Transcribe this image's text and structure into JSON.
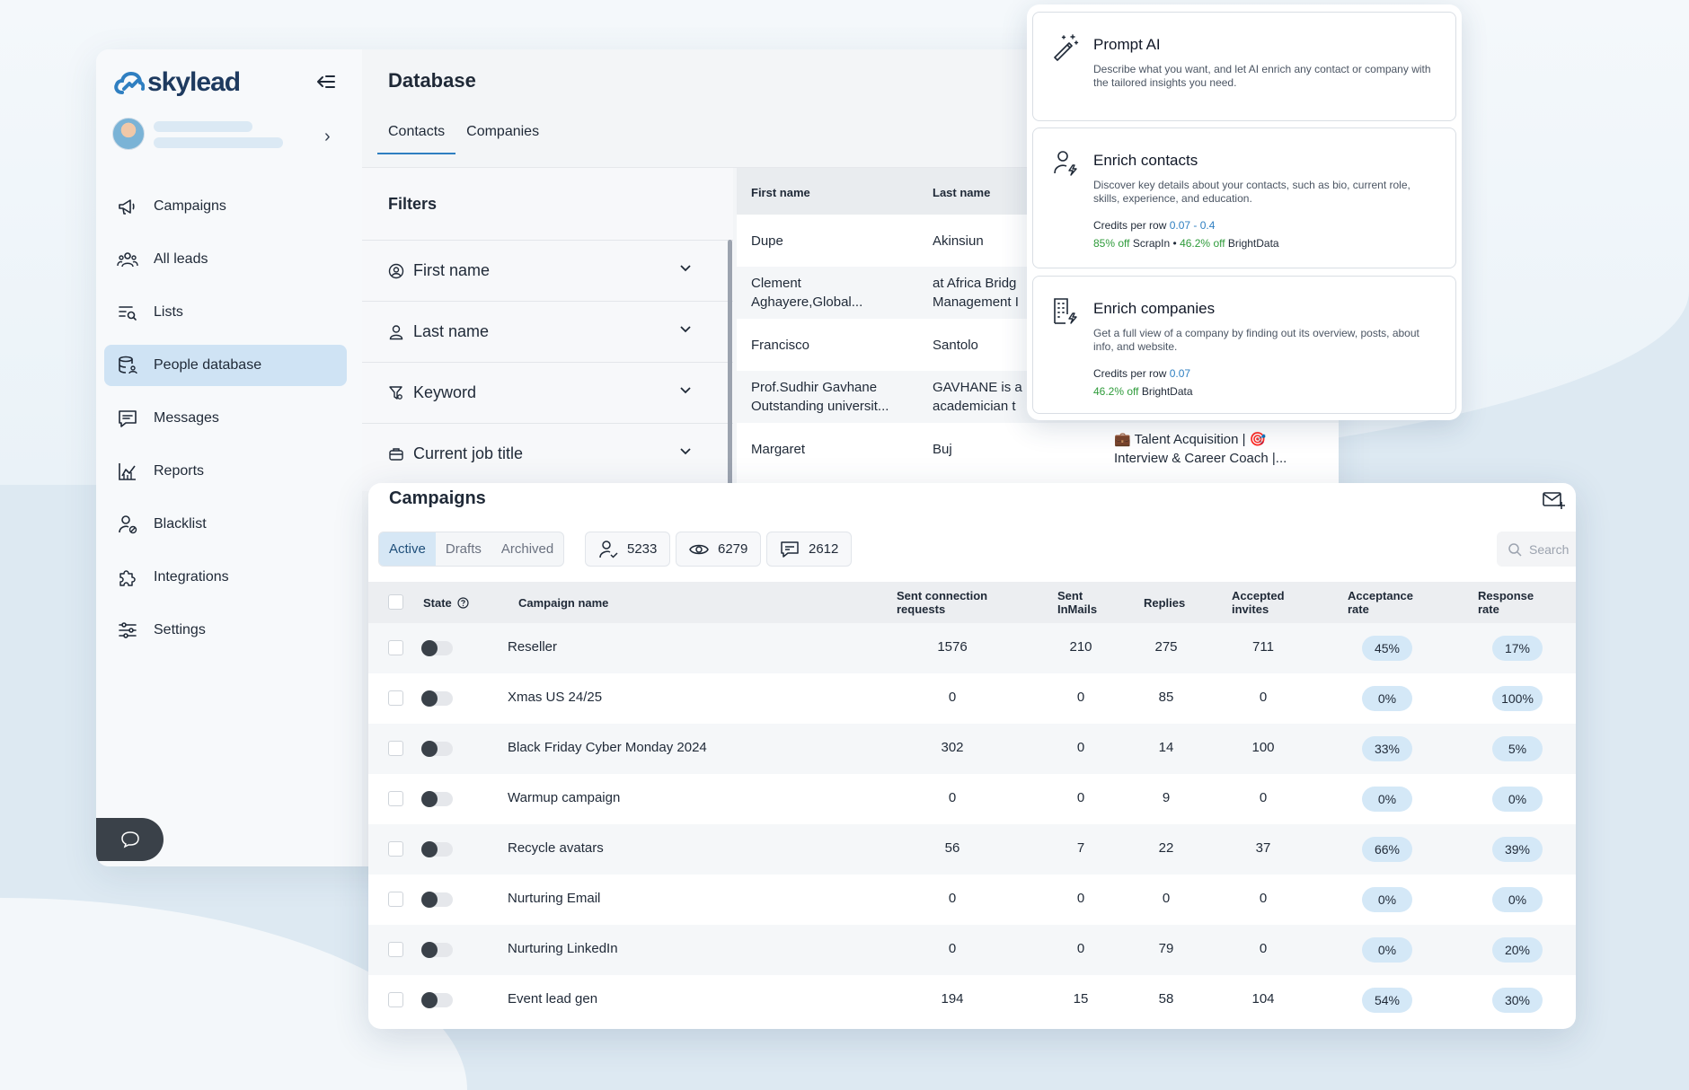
{
  "brand": {
    "name": "skylead",
    "accent": "#2f7fc1"
  },
  "sidebar": {
    "items": [
      {
        "label": "Campaigns",
        "icon": "megaphone-icon"
      },
      {
        "label": "All leads",
        "icon": "users-icon"
      },
      {
        "label": "Lists",
        "icon": "list-search-icon"
      },
      {
        "label": "People database",
        "icon": "database-user-icon",
        "active": true
      },
      {
        "label": "Messages",
        "icon": "message-icon"
      },
      {
        "label": "Reports",
        "icon": "chart-icon"
      },
      {
        "label": "Blacklist",
        "icon": "user-blocked-icon"
      },
      {
        "label": "Integrations",
        "icon": "puzzle-icon"
      },
      {
        "label": "Settings",
        "icon": "sliders-icon"
      }
    ]
  },
  "database": {
    "title": "Database",
    "tabs": [
      "Contacts",
      "Companies"
    ],
    "filters_title": "Filters",
    "filters": [
      "First name",
      "Last name",
      "Keyword",
      "Current job title"
    ],
    "columns": [
      "First name",
      "Last name"
    ],
    "rows": [
      {
        "first": "Dupe",
        "last": "Akinsiun",
        "extra": ""
      },
      {
        "first": "Clement Aghayere,Global...",
        "last": "at Africa Bridg Management I",
        "extra": ""
      },
      {
        "first": "Francisco",
        "last": "Santolo",
        "extra": ""
      },
      {
        "first": "Prof.Sudhir Gavhane Outstanding universit...",
        "last": "GAVHANE is a academician t",
        "extra": ""
      },
      {
        "first": "Margaret",
        "last": "Buj",
        "extra": "💼 Talent Acquisition | 🎯 Interview & Career Coach |..."
      }
    ]
  },
  "enrich": {
    "cards": [
      {
        "title": "Prompt AI",
        "desc": "Describe what you want, and let AI enrich any contact or company with the tailored insights you need.",
        "icon": "magic-wand-icon"
      },
      {
        "title": "Enrich contacts",
        "desc": "Discover key details about your contacts, such as bio, current role, skills, experience, and education.",
        "credits_label": "Credits per row",
        "credits_value": "0.07 - 0.4",
        "discount1": "85% off",
        "provider1": "ScrapIn",
        "sep": "•",
        "discount2": "46.2% off",
        "provider2": "BrightData",
        "icon": "user-bolt-icon"
      },
      {
        "title": "Enrich companies",
        "desc": "Get a full view of a company by finding out its overview, posts, about info, and website.",
        "credits_label": "Credits per row",
        "credits_value": "0.07",
        "discount2": "46.2% off",
        "provider2": "BrightData",
        "icon": "building-bolt-icon"
      }
    ]
  },
  "campaigns": {
    "title": "Campaigns",
    "segments": [
      "Active",
      "Drafts",
      "Archived"
    ],
    "stats": [
      {
        "value": "5233",
        "icon": "user-check-icon"
      },
      {
        "value": "6279",
        "icon": "eye-icon"
      },
      {
        "value": "2612",
        "icon": "message-check-icon"
      }
    ],
    "search_placeholder": "Search",
    "headers": {
      "state": "State",
      "name": "Campaign name",
      "sent_conn_1": "Sent connection",
      "sent_conn_2": "requests",
      "sent_inmails_1": "Sent",
      "sent_inmails_2": "InMails",
      "replies": "Replies",
      "accepted_1": "Accepted",
      "accepted_2": "invites",
      "acc_rate_1": "Acceptance",
      "acc_rate_2": "rate",
      "resp_rate_1": "Response",
      "resp_rate_2": "rate"
    },
    "rows": [
      {
        "name": "Reseller",
        "sent": "1576",
        "inmails": "210",
        "replies": "275",
        "accepted": "711",
        "acc_rate": "45%",
        "resp_rate": "17%"
      },
      {
        "name": "Xmas US 24/25",
        "sent": "0",
        "inmails": "0",
        "replies": "85",
        "accepted": "0",
        "acc_rate": "0%",
        "resp_rate": "100%"
      },
      {
        "name": "Black Friday Cyber Monday 2024",
        "sent": "302",
        "inmails": "0",
        "replies": "14",
        "accepted": "100",
        "acc_rate": "33%",
        "resp_rate": "5%"
      },
      {
        "name": "Warmup campaign",
        "sent": "0",
        "inmails": "0",
        "replies": "9",
        "accepted": "0",
        "acc_rate": "0%",
        "resp_rate": "0%"
      },
      {
        "name": "Recycle avatars",
        "sent": "56",
        "inmails": "7",
        "replies": "22",
        "accepted": "37",
        "acc_rate": "66%",
        "resp_rate": "39%"
      },
      {
        "name": "Nurturing Email",
        "sent": "0",
        "inmails": "0",
        "replies": "0",
        "accepted": "0",
        "acc_rate": "0%",
        "resp_rate": "0%"
      },
      {
        "name": "Nurturing LinkedIn",
        "sent": "0",
        "inmails": "0",
        "replies": "79",
        "accepted": "0",
        "acc_rate": "0%",
        "resp_rate": "20%"
      },
      {
        "name": "Event lead gen",
        "sent": "194",
        "inmails": "15",
        "replies": "58",
        "accepted": "104",
        "acc_rate": "54%",
        "resp_rate": "30%"
      }
    ]
  }
}
